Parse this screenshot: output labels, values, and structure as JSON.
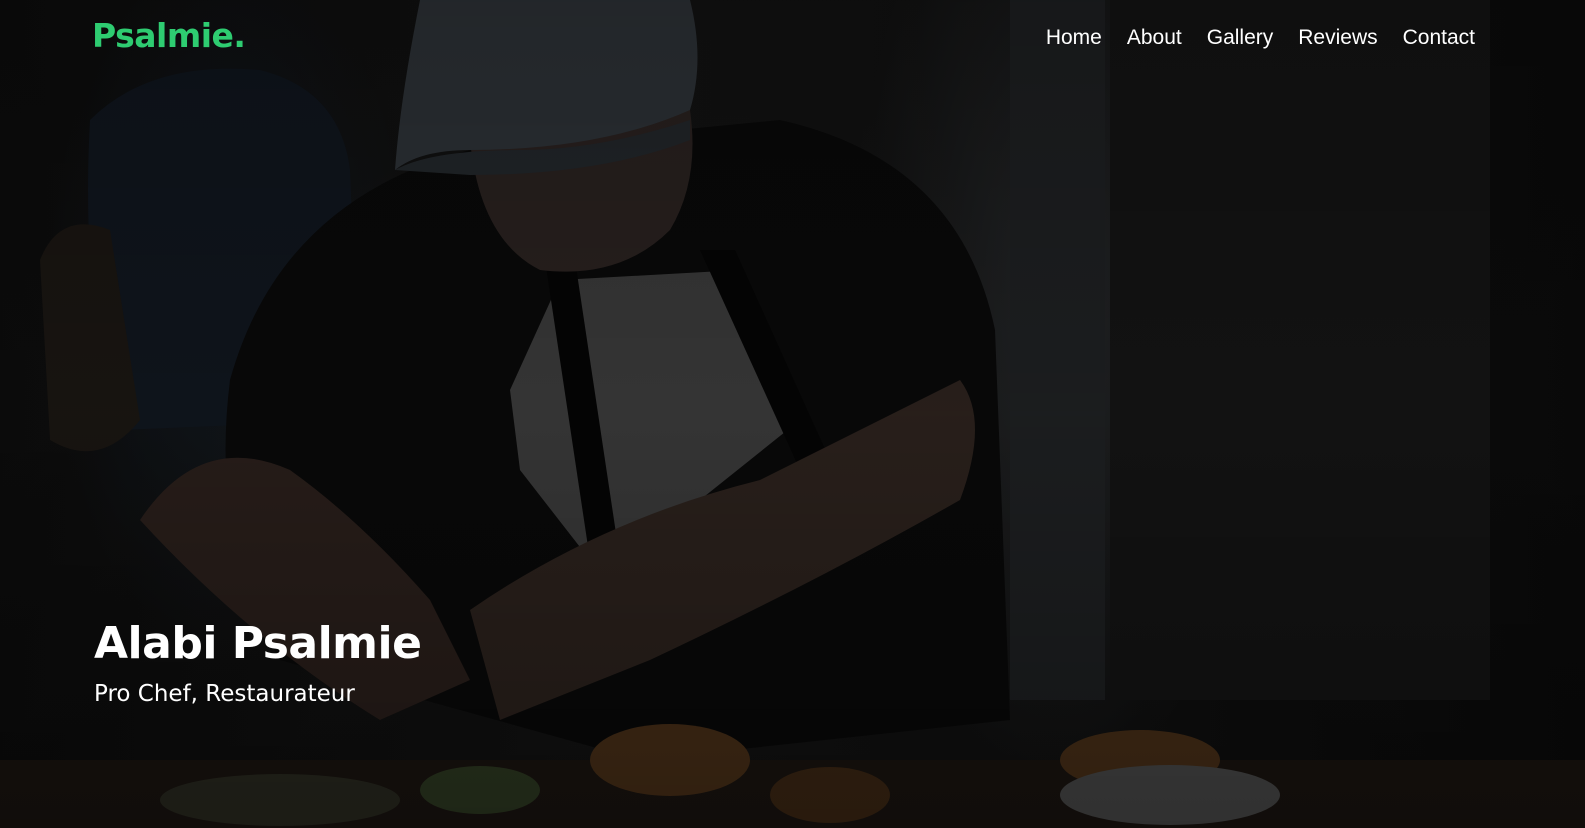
{
  "brand": {
    "logo": "Psalmie.",
    "accent_color": "#2ecc71"
  },
  "nav": {
    "items": [
      {
        "label": "Home"
      },
      {
        "label": "About"
      },
      {
        "label": "Gallery"
      },
      {
        "label": "Reviews"
      },
      {
        "label": "Contact"
      }
    ]
  },
  "hero": {
    "title": "Alabi Psalmie",
    "subtitle": "Pro Chef, Restaurateur",
    "background_image": "chef-preparing-burgers-photo"
  }
}
